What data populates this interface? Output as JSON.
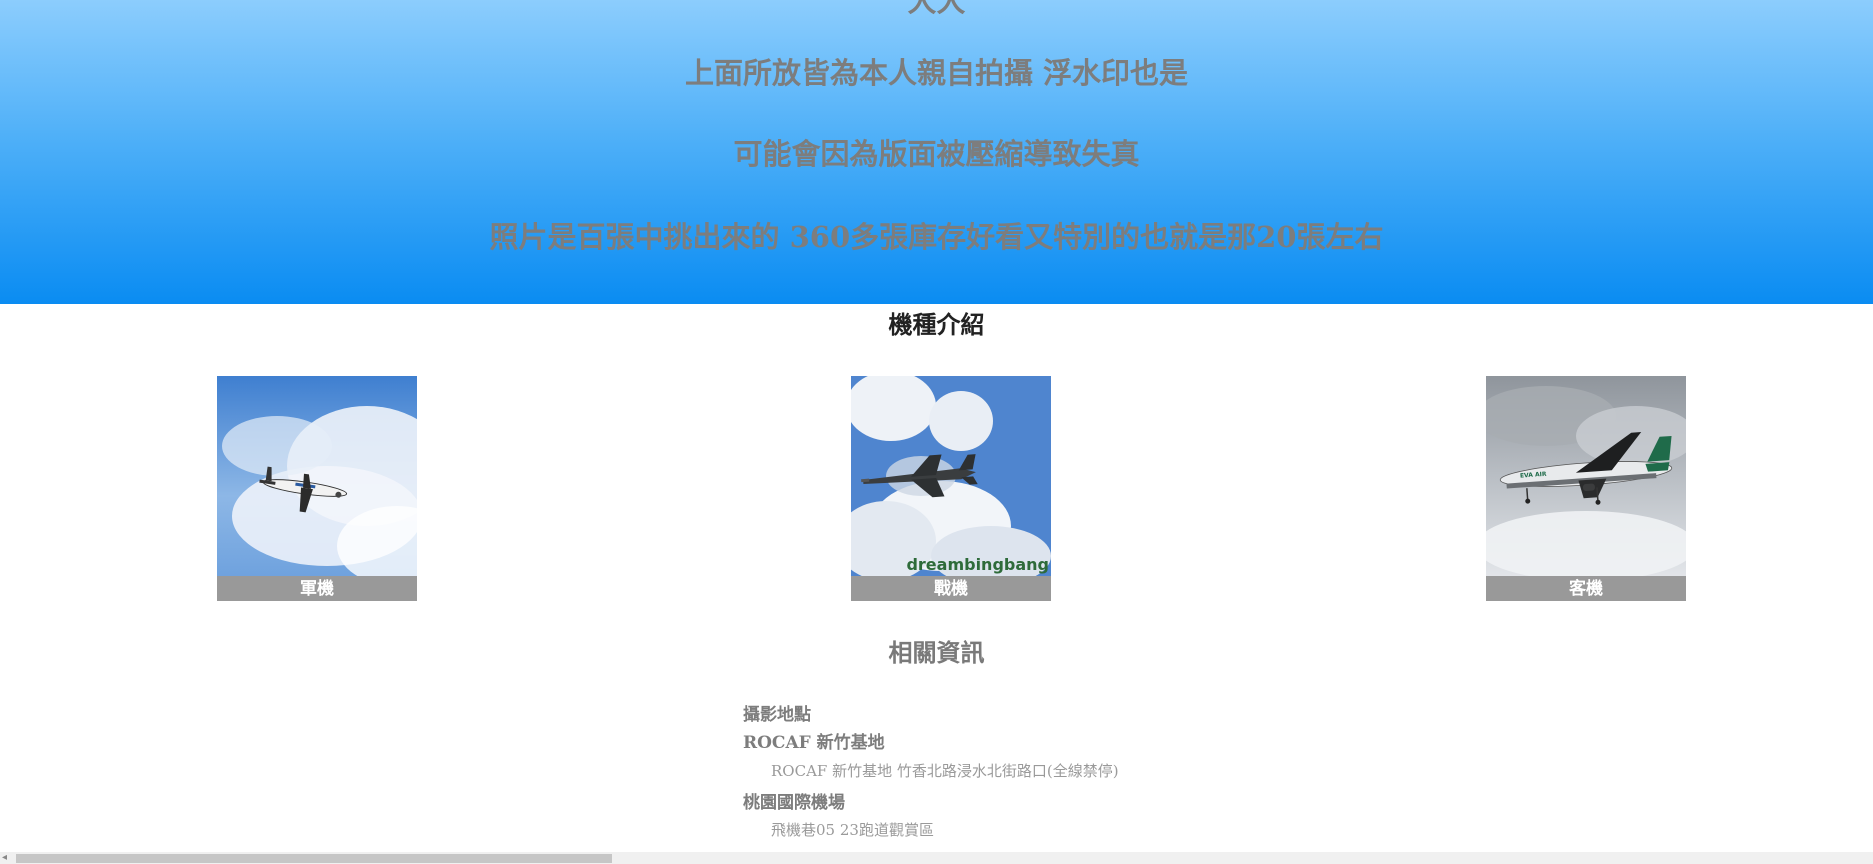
{
  "hero": {
    "clipped_top": "大大",
    "line1": "上面所放皆為本人親自拍攝 浮水印也是",
    "line2": "可能會因為版面被壓縮導致失真",
    "line3": "照片是百張中挑出來的 360多張庫存好看又特別的也就是那20張左右"
  },
  "types": {
    "title": "機種介紹",
    "cards": [
      {
        "label": "軍機"
      },
      {
        "label": "戰機",
        "watermark": "dreambingbang"
      },
      {
        "label": "客機",
        "livery": "EVA AIR"
      }
    ]
  },
  "related": {
    "title": "相關資訊",
    "heading": "攝影地點",
    "locations": [
      {
        "name": "ROCAF 新竹基地",
        "detail": "ROCAF 新竹基地 竹香北路浸水北街路口(全線禁停)"
      },
      {
        "name": "桃園國際機場",
        "detail": "飛機巷05 23跑道觀賞區"
      }
    ]
  },
  "colors": {
    "hero_top": "#8ccdfd",
    "hero_bottom": "#0a8cf2",
    "caption_bg": "#999999",
    "text_gray": "#7d7d7d"
  }
}
